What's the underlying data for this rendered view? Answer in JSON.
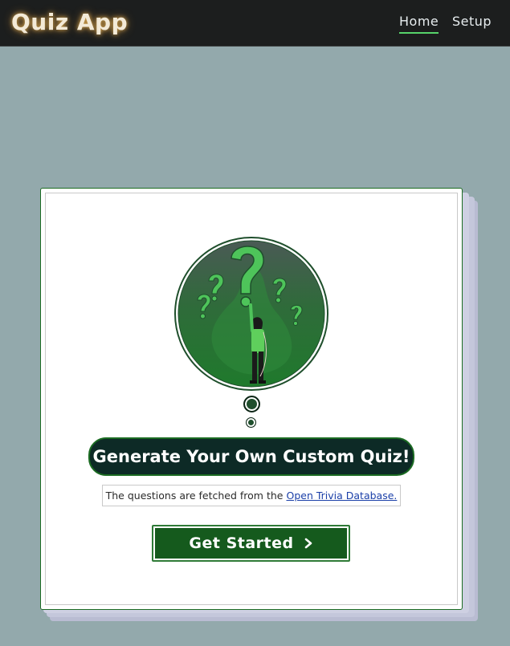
{
  "navbar": {
    "brand": "Quiz App",
    "links": [
      {
        "label": "Home",
        "active": true
      },
      {
        "label": "Setup",
        "active": false
      }
    ]
  },
  "main": {
    "headline": "Generate Your Own Custom Quiz!",
    "info_prefix": "The questions are fetched from the",
    "info_link": "Open Trivia Database.",
    "cta_label": "Get Started",
    "cta_icon": "chevron-right-icon",
    "illustration": "question-marks-person-illustration"
  },
  "colors": {
    "background": "#93a9ac",
    "navbar": "#1c1e1e",
    "accent_green": "#155a1d",
    "headline_bg": "#0d2a26",
    "active_underline": "#56d46a"
  }
}
